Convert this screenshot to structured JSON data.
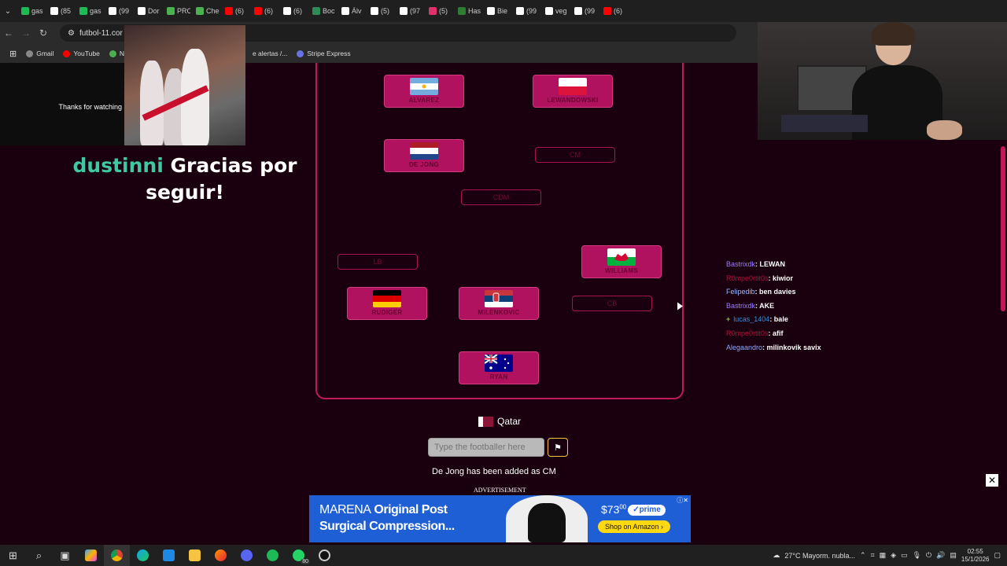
{
  "tabs": [
    {
      "label": "gas",
      "color": "#1db954"
    },
    {
      "label": "(85",
      "color": "#ffffff"
    },
    {
      "label": "gas",
      "color": "#1db954"
    },
    {
      "label": "(99",
      "color": "#ffffff"
    },
    {
      "label": "Dor",
      "color": "#ffffff"
    },
    {
      "label": "PRC",
      "color": "#4caf50"
    },
    {
      "label": "Che",
      "color": "#4caf50"
    },
    {
      "label": "(6)",
      "color": "#ff0000"
    },
    {
      "label": "(6)",
      "color": "#ff0000"
    },
    {
      "label": "(6)",
      "color": "#ffffff"
    },
    {
      "label": "Boc",
      "color": "#2e8b57"
    },
    {
      "label": "Álv",
      "color": "#ffffff"
    },
    {
      "label": "(5)",
      "color": "#ffffff"
    },
    {
      "label": "(97",
      "color": "#ffffff"
    },
    {
      "label": "(5)",
      "color": "#e1306c"
    },
    {
      "label": "Has",
      "color": "#2e7d32"
    },
    {
      "label": "Bie",
      "color": "#ffffff"
    },
    {
      "label": "(99",
      "color": "#ffffff"
    },
    {
      "label": "veg",
      "color": "#ffffff"
    },
    {
      "label": "(99",
      "color": "#ffffff"
    },
    {
      "label": "(6)",
      "color": "#ff0000"
    }
  ],
  "address": {
    "url": "futbol-11.cor"
  },
  "bookmarks": [
    {
      "label": "Gmail",
      "color": "#888888"
    },
    {
      "label": "YouTube",
      "color": "#ff0000"
    },
    {
      "label": "N",
      "color": "#4caf50"
    },
    {
      "label": "e alertas /...",
      "color": "#2b2b2b"
    },
    {
      "label": "Stripe Express",
      "color": "#6772e5"
    }
  ],
  "overlay": {
    "thanks": "Thanks for watching",
    "follow_user": "dustinni",
    "follow_text": " Gracias por seguir!"
  },
  "pitch": {
    "players": [
      {
        "name": "ALVAREZ",
        "flag": "argentina"
      },
      {
        "name": "LEWANDOWSKI",
        "flag": "poland"
      },
      {
        "name": "DE JONG",
        "flag": "netherlands"
      },
      {
        "name": "WILLIAMS",
        "flag": "wales"
      },
      {
        "name": "RUDIGER",
        "flag": "germany"
      },
      {
        "name": "MILENKOVIC",
        "flag": "serbia"
      },
      {
        "name": "RYAN",
        "flag": "australia"
      }
    ],
    "empty_slots": [
      "CM",
      "CDM",
      "LB",
      "CB"
    ]
  },
  "game": {
    "country": "Qatar",
    "input_placeholder": "Type the footballer here",
    "submit_icon": "flag-icon",
    "status": "De Jong has been added as CM"
  },
  "chat": [
    {
      "user": "Bastrixdk",
      "text": ": LEWAN",
      "color": "#9b7cff"
    },
    {
      "user": "R0mpe0rtit0s",
      "text": ": kiwior",
      "color": "#b3123b"
    },
    {
      "user": "Felipedib",
      "text": ": ben davies",
      "color": "#9fb8ff"
    },
    {
      "user": "Bastrixdk",
      "text": ": AKE",
      "color": "#9b7cff"
    },
    {
      "user": "lucas_1404",
      "text": ": bale",
      "color": "#3a8fd8",
      "badge": "+"
    },
    {
      "user": "R0mpe0rtit0s",
      "text": ": afif",
      "color": "#b3123b"
    },
    {
      "user": "Alegaandro",
      "text": ": milinkovik savix",
      "color": "#8fa6ff"
    }
  ],
  "ad": {
    "label": "ADVERTISEMENT",
    "brand": "MARENA",
    "title_line1": "Original Post",
    "title_line2": "Surgical Compression...",
    "price": "$73",
    "price_cents": "00",
    "prime": "✓prime",
    "shop": "Shop on Amazon  ›"
  },
  "taskbar": {
    "weather": "27°C  Mayorm. nubla...",
    "badge": "80",
    "time": "02:55",
    "date": "15/1/2026"
  }
}
